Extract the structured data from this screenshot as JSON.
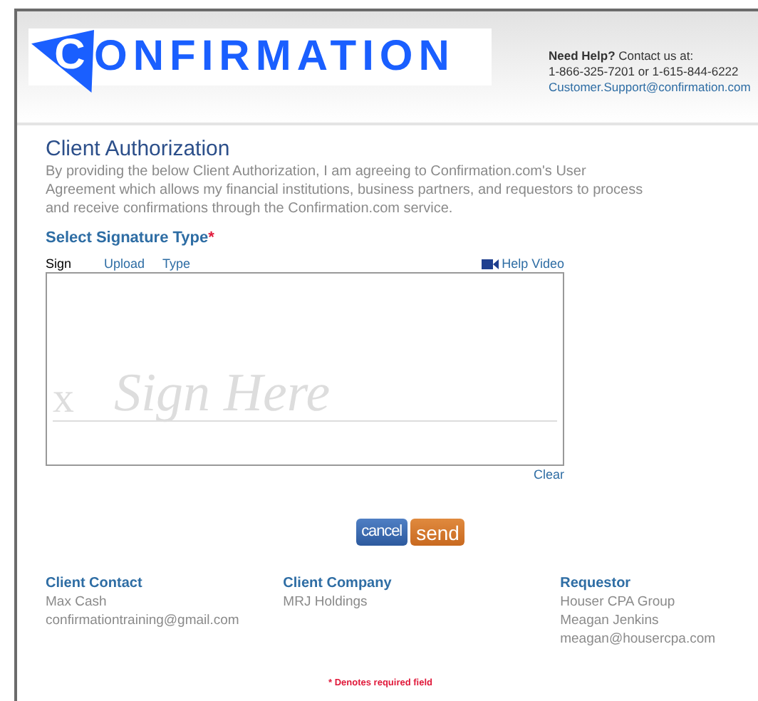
{
  "header": {
    "logo_mark": "C",
    "logo": "ONFIRMATION",
    "help": {
      "lead": "Need Help?",
      "text": " Contact us at:",
      "phone": "1-866-325-7201 or 1-615-844-6222",
      "email": "Customer.Support@confirmation.com"
    }
  },
  "title": "Client Authorization",
  "intro": "By providing the below Client Authorization, I am agreeing to Confirmation.com's User Agreement which allows my financial institutions, business partners, and requestors to process and receive confirmations through the Confirmation.com service.",
  "signature": {
    "heading": "Select Signature Type",
    "required_mark": "*",
    "tabs": [
      {
        "label": "Sign",
        "selected": true
      },
      {
        "label": "Upload",
        "selected": false
      },
      {
        "label": "Type",
        "selected": false
      }
    ],
    "help_video": "Help Video",
    "pad_mark": "x",
    "pad_hint": "Sign Here",
    "clear": "Clear"
  },
  "buttons": [
    {
      "label": "cancel",
      "kind": "cancel"
    },
    {
      "label": "send",
      "kind": "send"
    }
  ],
  "contacts": [
    {
      "heading": "Client Contact",
      "lines": [
        "Max Cash",
        "confirmationtraining@gmail.com"
      ]
    },
    {
      "heading": "Client Company",
      "lines": [
        "MRJ Holdings"
      ]
    },
    {
      "heading": "Requestor",
      "lines": [
        "Houser CPA Group",
        "Meagan Jenkins",
        "meagan@housercpa.com"
      ]
    }
  ],
  "footnote": "* Denotes required field"
}
